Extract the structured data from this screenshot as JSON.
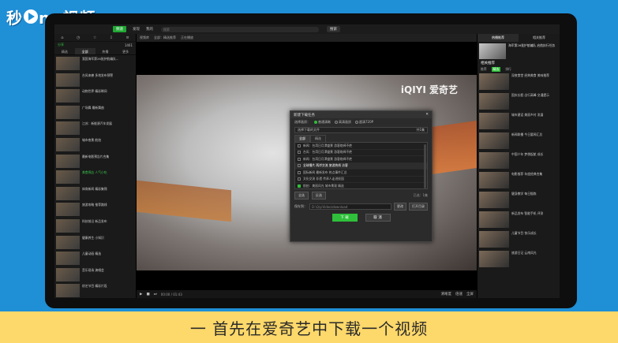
{
  "logo": {
    "part1": "秒",
    "part2": "ng视频",
    "mark": "d"
  },
  "topbar": {
    "channel": "频道",
    "nav": [
      "发现",
      "我的"
    ],
    "search_placeholder": "搜索",
    "search_button": "搜索",
    "right_items": [
      "登录",
      "开通VIP"
    ]
  },
  "left_panel": {
    "sub_left": "分享",
    "sub_count": "1461",
    "tabs": [
      "精选",
      "全部",
      "热播",
      "更多"
    ],
    "items": [
      {
        "title": "我国海军第26批护航编队..."
      },
      {
        "title": "台风来袭 多地发布预警"
      },
      {
        "title": "动物世界 精彩瞬间"
      },
      {
        "title": "广场舞 最新舞曲"
      },
      {
        "title": "江苏：新能源汽车发展"
      },
      {
        "title": "城市夜景 航拍"
      },
      {
        "title": "最新电影预告片合集"
      },
      {
        "title": "美食探店 人气小吃",
        "highlight": true
      },
      {
        "title": "体育新闻 精彩集锦"
      },
      {
        "title": "旅游攻略 推荐路线"
      },
      {
        "title": "科技前沿 新品发布"
      },
      {
        "title": "健康养生 小知识"
      },
      {
        "title": "儿童动画 精选"
      },
      {
        "title": "音乐现场 演唱会"
      },
      {
        "title": "综艺节目 精彩片段"
      },
      {
        "title": "纪录片 自然风光"
      }
    ]
  },
  "video": {
    "header": [
      "视频库",
      "全部：精选推荐",
      "正在播放"
    ],
    "watermark": "iQIYI 爱奇艺",
    "time": "00:00 / 01:43",
    "controls_right": [
      "清晰度",
      "倍速",
      "全屏"
    ]
  },
  "dialog": {
    "title": "新建下载任务",
    "quality_label": "选择画质：",
    "qualities": [
      "普通清晰",
      "高清画质",
      "超清720P"
    ],
    "select_label": "选择下载的文件",
    "select_count": "共1集",
    "ep_tabs": [
      "全部",
      "精选"
    ],
    "episodes": [
      {
        "text": "新闻：台湾日月潭盛景 游客络绎不绝",
        "checked": false
      },
      {
        "text": "台风：台湾日月潭盛景 游客络绎不绝",
        "checked": false
      },
      {
        "text": "新闻：台湾日月潭盛景 游客络绎不绝",
        "checked": false
      },
      {
        "text": "全球播片 两岸交流 旅游热线 访客",
        "checked": false,
        "selected": true
      },
      {
        "text": "国际新闻 最新发布 热点事件汇总",
        "checked": false
      },
      {
        "text": "文化交流 非遗 传承人走进校园",
        "checked": false
      },
      {
        "text": "航拍：美丽风光 城市景观 精选",
        "checked": true
      }
    ],
    "select_all": "全选",
    "invert": "反选",
    "info": "已选：1集",
    "path_label": "保存到：",
    "path": "D:\\QiyiVideo\\download",
    "path_btn1": "更改",
    "path_btn2": "打开目录",
    "ok": "下 载",
    "cancel": "取 消"
  },
  "right_panel": {
    "tabs": [
      "热播推荐",
      "相关推荐"
    ],
    "feature": {
      "title": "海军第26批护航编队 启航执行任务"
    },
    "section": "相关推荐",
    "subtabs": [
      "推荐",
      "精选",
      "排行"
    ],
    "items": [
      {
        "title": "深夜食堂 经典美食 美味推荐"
      },
      {
        "title": "国庆长假 出行高峰 交通提示"
      },
      {
        "title": "城市建设 美丽乡村 发展"
      },
      {
        "title": "新闻联播 今日要闻汇总"
      },
      {
        "title": "中国少年 梦想起航 成长"
      },
      {
        "title": "电影推荐 年度经典合集"
      },
      {
        "title": "健身教学 每日锻炼"
      },
      {
        "title": "新品发布 智能手机 评测"
      },
      {
        "title": "儿童节目 快乐成长"
      },
      {
        "title": "旅游日记 云南风光"
      }
    ]
  },
  "caption": "一 首先在爱奇艺中下载一个视频"
}
